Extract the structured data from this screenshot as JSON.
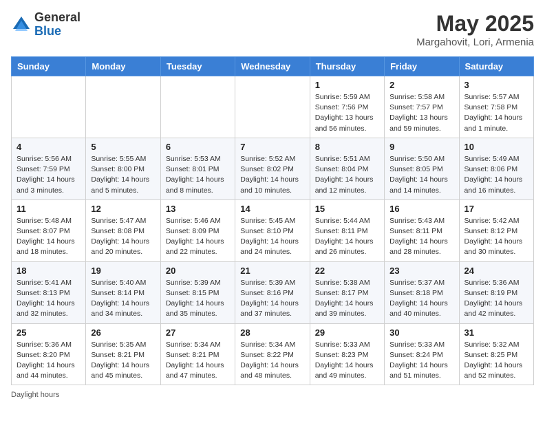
{
  "header": {
    "logo_general": "General",
    "logo_blue": "Blue",
    "title": "May 2025",
    "location": "Margahovit, Lori, Armenia"
  },
  "footer": {
    "note": "Daylight hours"
  },
  "days_of_week": [
    "Sunday",
    "Monday",
    "Tuesday",
    "Wednesday",
    "Thursday",
    "Friday",
    "Saturday"
  ],
  "weeks": [
    {
      "days": [
        {
          "num": "",
          "info": ""
        },
        {
          "num": "",
          "info": ""
        },
        {
          "num": "",
          "info": ""
        },
        {
          "num": "",
          "info": ""
        },
        {
          "num": "1",
          "info": "Sunrise: 5:59 AM\nSunset: 7:56 PM\nDaylight: 13 hours\nand 56 minutes."
        },
        {
          "num": "2",
          "info": "Sunrise: 5:58 AM\nSunset: 7:57 PM\nDaylight: 13 hours\nand 59 minutes."
        },
        {
          "num": "3",
          "info": "Sunrise: 5:57 AM\nSunset: 7:58 PM\nDaylight: 14 hours\nand 1 minute."
        }
      ]
    },
    {
      "days": [
        {
          "num": "4",
          "info": "Sunrise: 5:56 AM\nSunset: 7:59 PM\nDaylight: 14 hours\nand 3 minutes."
        },
        {
          "num": "5",
          "info": "Sunrise: 5:55 AM\nSunset: 8:00 PM\nDaylight: 14 hours\nand 5 minutes."
        },
        {
          "num": "6",
          "info": "Sunrise: 5:53 AM\nSunset: 8:01 PM\nDaylight: 14 hours\nand 8 minutes."
        },
        {
          "num": "7",
          "info": "Sunrise: 5:52 AM\nSunset: 8:02 PM\nDaylight: 14 hours\nand 10 minutes."
        },
        {
          "num": "8",
          "info": "Sunrise: 5:51 AM\nSunset: 8:04 PM\nDaylight: 14 hours\nand 12 minutes."
        },
        {
          "num": "9",
          "info": "Sunrise: 5:50 AM\nSunset: 8:05 PM\nDaylight: 14 hours\nand 14 minutes."
        },
        {
          "num": "10",
          "info": "Sunrise: 5:49 AM\nSunset: 8:06 PM\nDaylight: 14 hours\nand 16 minutes."
        }
      ]
    },
    {
      "days": [
        {
          "num": "11",
          "info": "Sunrise: 5:48 AM\nSunset: 8:07 PM\nDaylight: 14 hours\nand 18 minutes."
        },
        {
          "num": "12",
          "info": "Sunrise: 5:47 AM\nSunset: 8:08 PM\nDaylight: 14 hours\nand 20 minutes."
        },
        {
          "num": "13",
          "info": "Sunrise: 5:46 AM\nSunset: 8:09 PM\nDaylight: 14 hours\nand 22 minutes."
        },
        {
          "num": "14",
          "info": "Sunrise: 5:45 AM\nSunset: 8:10 PM\nDaylight: 14 hours\nand 24 minutes."
        },
        {
          "num": "15",
          "info": "Sunrise: 5:44 AM\nSunset: 8:11 PM\nDaylight: 14 hours\nand 26 minutes."
        },
        {
          "num": "16",
          "info": "Sunrise: 5:43 AM\nSunset: 8:11 PM\nDaylight: 14 hours\nand 28 minutes."
        },
        {
          "num": "17",
          "info": "Sunrise: 5:42 AM\nSunset: 8:12 PM\nDaylight: 14 hours\nand 30 minutes."
        }
      ]
    },
    {
      "days": [
        {
          "num": "18",
          "info": "Sunrise: 5:41 AM\nSunset: 8:13 PM\nDaylight: 14 hours\nand 32 minutes."
        },
        {
          "num": "19",
          "info": "Sunrise: 5:40 AM\nSunset: 8:14 PM\nDaylight: 14 hours\nand 34 minutes."
        },
        {
          "num": "20",
          "info": "Sunrise: 5:39 AM\nSunset: 8:15 PM\nDaylight: 14 hours\nand 35 minutes."
        },
        {
          "num": "21",
          "info": "Sunrise: 5:39 AM\nSunset: 8:16 PM\nDaylight: 14 hours\nand 37 minutes."
        },
        {
          "num": "22",
          "info": "Sunrise: 5:38 AM\nSunset: 8:17 PM\nDaylight: 14 hours\nand 39 minutes."
        },
        {
          "num": "23",
          "info": "Sunrise: 5:37 AM\nSunset: 8:18 PM\nDaylight: 14 hours\nand 40 minutes."
        },
        {
          "num": "24",
          "info": "Sunrise: 5:36 AM\nSunset: 8:19 PM\nDaylight: 14 hours\nand 42 minutes."
        }
      ]
    },
    {
      "days": [
        {
          "num": "25",
          "info": "Sunrise: 5:36 AM\nSunset: 8:20 PM\nDaylight: 14 hours\nand 44 minutes."
        },
        {
          "num": "26",
          "info": "Sunrise: 5:35 AM\nSunset: 8:21 PM\nDaylight: 14 hours\nand 45 minutes."
        },
        {
          "num": "27",
          "info": "Sunrise: 5:34 AM\nSunset: 8:21 PM\nDaylight: 14 hours\nand 47 minutes."
        },
        {
          "num": "28",
          "info": "Sunrise: 5:34 AM\nSunset: 8:22 PM\nDaylight: 14 hours\nand 48 minutes."
        },
        {
          "num": "29",
          "info": "Sunrise: 5:33 AM\nSunset: 8:23 PM\nDaylight: 14 hours\nand 49 minutes."
        },
        {
          "num": "30",
          "info": "Sunrise: 5:33 AM\nSunset: 8:24 PM\nDaylight: 14 hours\nand 51 minutes."
        },
        {
          "num": "31",
          "info": "Sunrise: 5:32 AM\nSunset: 8:25 PM\nDaylight: 14 hours\nand 52 minutes."
        }
      ]
    }
  ]
}
